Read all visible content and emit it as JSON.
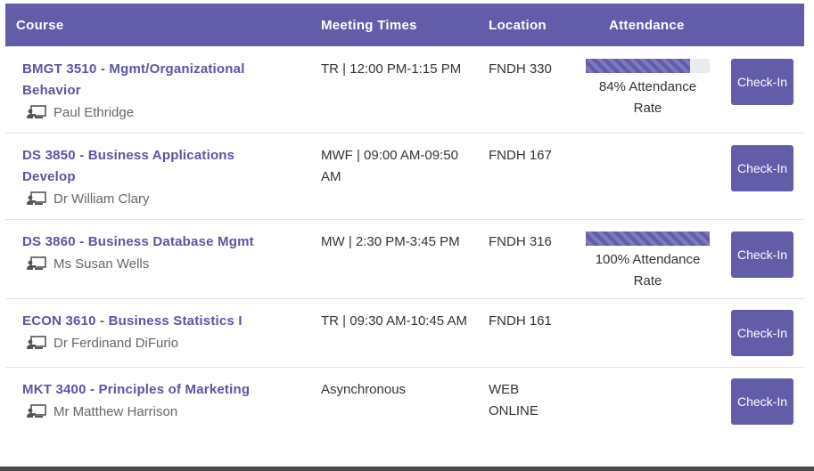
{
  "header": {
    "course": "Course",
    "meeting_times": "Meeting Times",
    "location": "Location",
    "attendance": "Attendance"
  },
  "courses": [
    {
      "title": "BMGT 3510 - Mgmt/Organizational Behavior",
      "instructor": "Paul Ethridge",
      "times": "TR | 12:00 PM-1:15 PM",
      "location": "FNDH 330",
      "attendance_rate": 84,
      "attendance_text": "84% Attendance Rate",
      "button": "Check-In"
    },
    {
      "title": "DS 3850 - Business Applications Develop",
      "instructor": "Dr William Clary",
      "times": "MWF | 09:00 AM-09:50 AM",
      "location": "FNDH 167",
      "button": "Check-In"
    },
    {
      "title": "DS 3860 - Business Database Mgmt",
      "instructor": "Ms Susan Wells",
      "times": "MW | 2:30 PM-3:45 PM",
      "location": "FNDH 316",
      "attendance_rate": 100,
      "attendance_text": "100% Attendance Rate",
      "button": "Check-In"
    },
    {
      "title": "ECON 3610 - Business Statistics I",
      "instructor": "Dr Ferdinand DiFurio",
      "times": "TR | 09:30 AM-10:45 AM",
      "location": "FNDH 161",
      "button": "Check-In"
    },
    {
      "title": "MKT 3400 - Principles of Marketing",
      "instructor": "Mr Matthew Harrison",
      "times": "Asynchronous",
      "location": "WEB ONLINE",
      "button": "Check-In"
    }
  ],
  "icons": {
    "instructor": "teacher-board-icon"
  },
  "colors": {
    "accent": "#625ca9",
    "course_link": "#5b55a3"
  }
}
